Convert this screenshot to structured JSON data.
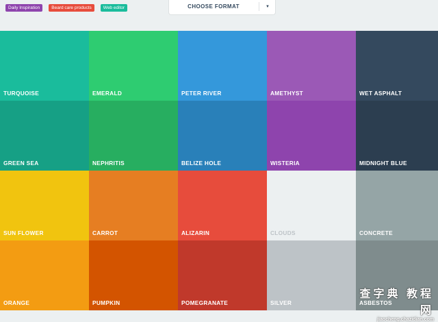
{
  "tags": [
    {
      "label": "Daily Inspiration",
      "color": "#8e44ad"
    },
    {
      "label": "Beard care products",
      "color": "#e74c3c"
    },
    {
      "label": "Web editor",
      "color": "#1abc9c"
    }
  ],
  "format": {
    "label": "CHOOSE FORMAT",
    "arrow": "▼"
  },
  "swatches": [
    {
      "name": "TURQUOISE",
      "color": "#1abc9c",
      "text_color": "#ffffff"
    },
    {
      "name": "EMERALD",
      "color": "#2ecc71",
      "text_color": "#ffffff"
    },
    {
      "name": "PETER RIVER",
      "color": "#3498db",
      "text_color": "#ffffff"
    },
    {
      "name": "AMETHYST",
      "color": "#9b59b6",
      "text_color": "#ffffff"
    },
    {
      "name": "WET ASPHALT",
      "color": "#34495e",
      "text_color": "#ffffff"
    },
    {
      "name": "GREEN SEA",
      "color": "#16a085",
      "text_color": "#ffffff"
    },
    {
      "name": "NEPHRITIS",
      "color": "#27ae60",
      "text_color": "#ffffff"
    },
    {
      "name": "BELIZE HOLE",
      "color": "#2980b9",
      "text_color": "#ffffff"
    },
    {
      "name": "WISTERIA",
      "color": "#8e44ad",
      "text_color": "#ffffff"
    },
    {
      "name": "MIDNIGHT BLUE",
      "color": "#2c3e50",
      "text_color": "#ffffff"
    },
    {
      "name": "SUN FLOWER",
      "color": "#f1c40f",
      "text_color": "#ffffff"
    },
    {
      "name": "CARROT",
      "color": "#e67e22",
      "text_color": "#ffffff"
    },
    {
      "name": "ALIZARIN",
      "color": "#e74c3c",
      "text_color": "#ffffff"
    },
    {
      "name": "CLOUDS",
      "color": "#ecf0f1",
      "text_color": "#bdc3c7"
    },
    {
      "name": "CONCRETE",
      "color": "#95a5a6",
      "text_color": "#ffffff"
    },
    {
      "name": "ORANGE",
      "color": "#f39c12",
      "text_color": "#ffffff"
    },
    {
      "name": "PUMPKIN",
      "color": "#d35400",
      "text_color": "#ffffff"
    },
    {
      "name": "POMEGRANATE",
      "color": "#c0392b",
      "text_color": "#ffffff"
    },
    {
      "name": "SILVER",
      "color": "#bdc3c7",
      "text_color": "#ffffff"
    },
    {
      "name": "ASBESTOS",
      "color": "#7f8c8d",
      "text_color": "#ffffff"
    }
  ],
  "watermark": {
    "text": "查字典 教程网",
    "url": "jiaocheng.chazidian.com"
  }
}
